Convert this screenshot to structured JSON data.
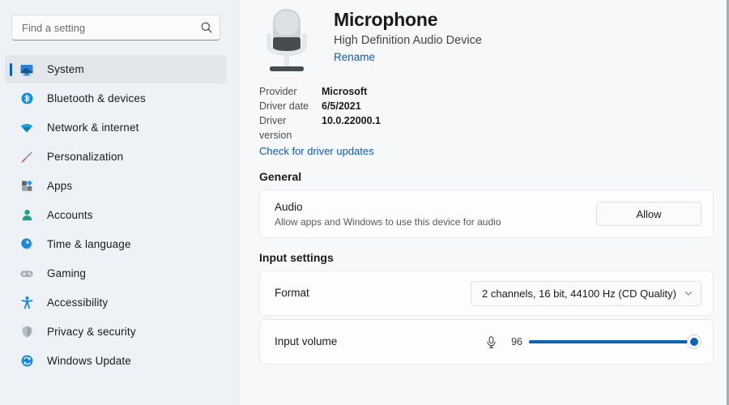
{
  "search": {
    "placeholder": "Find a setting",
    "value": "",
    "icon": "search-icon"
  },
  "sidebar": {
    "items": [
      {
        "label": "System",
        "icon": "monitor-icon",
        "selected": true
      },
      {
        "label": "Bluetooth & devices",
        "icon": "bluetooth-icon",
        "selected": false
      },
      {
        "label": "Network & internet",
        "icon": "wifi-icon",
        "selected": false
      },
      {
        "label": "Personalization",
        "icon": "paintbrush-icon",
        "selected": false
      },
      {
        "label": "Apps",
        "icon": "apps-icon",
        "selected": false
      },
      {
        "label": "Accounts",
        "icon": "person-icon",
        "selected": false
      },
      {
        "label": "Time & language",
        "icon": "clock-icon",
        "selected": false
      },
      {
        "label": "Gaming",
        "icon": "gamepad-icon",
        "selected": false
      },
      {
        "label": "Accessibility",
        "icon": "accessibility-icon",
        "selected": false
      },
      {
        "label": "Privacy & security",
        "icon": "shield-icon",
        "selected": false
      },
      {
        "label": "Windows Update",
        "icon": "update-icon",
        "selected": false
      }
    ]
  },
  "device": {
    "icon": "microphone-icon",
    "title": "Microphone",
    "subtitle": "High Definition Audio Device",
    "rename_label": "Rename",
    "properties": [
      {
        "key": "Provider",
        "value": "Microsoft"
      },
      {
        "key": "Driver date",
        "value": "6/5/2021"
      },
      {
        "key": "Driver version",
        "value": "10.0.22000.1"
      }
    ],
    "driver_update_link": "Check for driver updates"
  },
  "general": {
    "heading": "General",
    "audio": {
      "title": "Audio",
      "description": "Allow apps and Windows to use this device for audio",
      "button_label": "Allow"
    }
  },
  "input_settings": {
    "heading": "Input settings",
    "format": {
      "label": "Format",
      "value": "2 channels, 16 bit, 44100 Hz (CD Quality)",
      "chevron": "chevron-down-icon"
    },
    "input_volume": {
      "label": "Input volume",
      "icon": "microphone-small-icon",
      "value": "96",
      "percent": 96
    }
  },
  "annotation": {
    "arrow": "red-arrow-icon",
    "color": "#e01b1b"
  },
  "colors": {
    "accent": "#0b63b5",
    "link": "#0f5aa8",
    "sidebar_bg": "#eef1f5",
    "content_bg": "#f7f8fa",
    "card_bg": "#fdfdfe",
    "selected_bg": "#e3e7ec"
  }
}
